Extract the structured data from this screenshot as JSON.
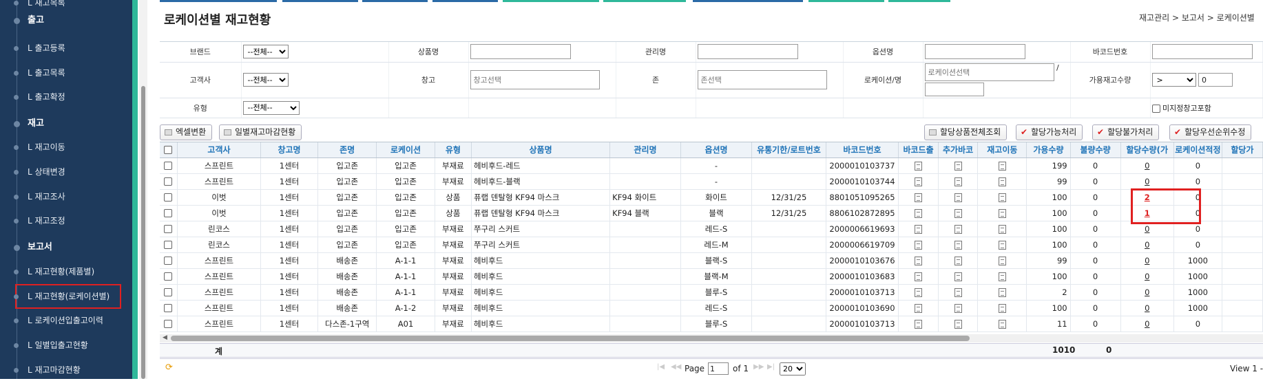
{
  "sidebar": {
    "top_partial": "L 재고목록",
    "sections": [
      {
        "label": "출고",
        "items": [
          "L 출고등록",
          "L 출고목록",
          "L 출고확정"
        ]
      },
      {
        "label": "재고",
        "items": [
          "L 재고이동",
          "L 상태변경",
          "L 재고조사",
          "L 재고조정"
        ]
      },
      {
        "label": "보고서",
        "items": [
          "L 재고현황(제품별)",
          "L 재고현황(로케이션별)",
          "L 로케이션입출고이력",
          "L 일별입출고현황",
          "L 재고마감현황"
        ]
      }
    ]
  },
  "header": {
    "title": "로케이션별 재고현황",
    "breadcrumb": "재고관리 > 보고서 > 로케이션별"
  },
  "filters": {
    "brand_label": "브랜드",
    "brand_value": "--전체--",
    "product_label": "상품명",
    "manage_label": "관리명",
    "option_label": "옵션명",
    "barcode_label": "바코드번호",
    "client_label": "고객사",
    "client_value": "--전체--",
    "warehouse_label": "창고",
    "warehouse_placeholder": "창고선택",
    "zone_label": "존",
    "zone_placeholder": "존선택",
    "location_label": "로케이션/명",
    "location_placeholder": "로케이션선택",
    "location_sep": "/",
    "avail_label": "가용재고수량",
    "avail_op": ">",
    "avail_value": "0",
    "type_label": "유형",
    "type_value": "--전체--",
    "include_label": "미지정창고포함"
  },
  "buttons": {
    "excel": "엑셀변환",
    "daily": "일별재고마감현황",
    "alloc_all": "할당상품전체조회",
    "alloc_ok": "할당가능처리",
    "alloc_no": "할당불가처리",
    "alloc_prio": "할당우선순위수정"
  },
  "grid": {
    "columns": [
      "고객사",
      "창고명",
      "존명",
      "로케이션",
      "유형",
      "상품명",
      "관리명",
      "옵션명",
      "유통기한/로트번호",
      "바코드번호",
      "바코드출",
      "추가바코",
      "재고이동",
      "가용수량",
      "불량수량",
      "할당수량(가",
      "로케이션적정",
      "할당가"
    ],
    "rows": [
      {
        "client": "스프린트",
        "wh": "1센터",
        "zone": "입고존",
        "loc": "입고존",
        "type": "부재료",
        "name": "헤비후드-레드",
        "manage": "",
        "option": "-",
        "lot": "",
        "barcode": "2000010103737",
        "avail": "199",
        "bad": "0",
        "alloc": "0",
        "proper": "0"
      },
      {
        "client": "스프린트",
        "wh": "1센터",
        "zone": "입고존",
        "loc": "입고존",
        "type": "부재료",
        "name": "헤비후드-블랙",
        "manage": "",
        "option": "-",
        "lot": "",
        "barcode": "2000010103744",
        "avail": "99",
        "bad": "0",
        "alloc": "0",
        "proper": "0"
      },
      {
        "client": "이벗",
        "wh": "1센터",
        "zone": "입고존",
        "loc": "입고존",
        "type": "상품",
        "name": "퓨랩 덴탈형 KF94 마스크",
        "manage": "KF94 화이트",
        "option": "화이트",
        "lot": "12/31/25",
        "barcode": "8801051095265",
        "avail": "100",
        "bad": "0",
        "alloc": "2",
        "proper": "0",
        "alloc_red": true
      },
      {
        "client": "이벗",
        "wh": "1센터",
        "zone": "입고존",
        "loc": "입고존",
        "type": "상품",
        "name": "퓨랩 덴탈형 KF94 마스크",
        "manage": "KF94 블랙",
        "option": "블랙",
        "lot": "12/31/25",
        "barcode": "8806102872895",
        "avail": "100",
        "bad": "0",
        "alloc": "1",
        "proper": "0",
        "alloc_red": true
      },
      {
        "client": "린코스",
        "wh": "1센터",
        "zone": "입고존",
        "loc": "입고존",
        "type": "부재료",
        "name": "쭈구리 스커트",
        "manage": "",
        "option": "레드-S",
        "lot": "",
        "barcode": "2000006619693",
        "avail": "100",
        "bad": "0",
        "alloc": "0",
        "proper": "0"
      },
      {
        "client": "린코스",
        "wh": "1센터",
        "zone": "입고존",
        "loc": "입고존",
        "type": "부재료",
        "name": "쭈구리 스커트",
        "manage": "",
        "option": "레드-M",
        "lot": "",
        "barcode": "2000006619709",
        "avail": "100",
        "bad": "0",
        "alloc": "0",
        "proper": "0"
      },
      {
        "client": "스프린트",
        "wh": "1센터",
        "zone": "배송존",
        "loc": "A-1-1",
        "type": "부재료",
        "name": "헤비후드",
        "manage": "",
        "option": "블랙-S",
        "lot": "",
        "barcode": "2000010103676",
        "avail": "99",
        "bad": "0",
        "alloc": "0",
        "proper": "1000"
      },
      {
        "client": "스프린트",
        "wh": "1센터",
        "zone": "배송존",
        "loc": "A-1-1",
        "type": "부재료",
        "name": "헤비후드",
        "manage": "",
        "option": "블랙-M",
        "lot": "",
        "barcode": "2000010103683",
        "avail": "100",
        "bad": "0",
        "alloc": "0",
        "proper": "1000"
      },
      {
        "client": "스프린트",
        "wh": "1센터",
        "zone": "배송존",
        "loc": "A-1-1",
        "type": "부재료",
        "name": "헤비후드",
        "manage": "",
        "option": "블루-S",
        "lot": "",
        "barcode": "2000010103713",
        "avail": "2",
        "bad": "0",
        "alloc": "0",
        "proper": "1000"
      },
      {
        "client": "스프린트",
        "wh": "1센터",
        "zone": "배송존",
        "loc": "A-1-2",
        "type": "부재료",
        "name": "헤비후드",
        "manage": "",
        "option": "레드-S",
        "lot": "",
        "barcode": "2000010103690",
        "avail": "100",
        "bad": "0",
        "alloc": "0",
        "proper": "1000"
      },
      {
        "client": "스프린트",
        "wh": "1센터",
        "zone": "다스존-1구역",
        "loc": "A01",
        "type": "부재료",
        "name": "헤비후드",
        "manage": "",
        "option": "블루-S",
        "lot": "",
        "barcode": "2000010103713",
        "avail": "11",
        "bad": "0",
        "alloc": "0",
        "proper": "0"
      }
    ],
    "total_label": "계",
    "total_avail": "1010",
    "total_bad": "0"
  },
  "pager": {
    "page_label": "Page",
    "page_value": "1",
    "of_label": "of 1",
    "size_value": "20",
    "view_label": "View 1 -"
  },
  "colors": {
    "sidebar_bg": "#1e3a5c",
    "sidebar_accent": "#2fb89a",
    "header_text": "#1f73b7",
    "highlight": "#e02020"
  }
}
